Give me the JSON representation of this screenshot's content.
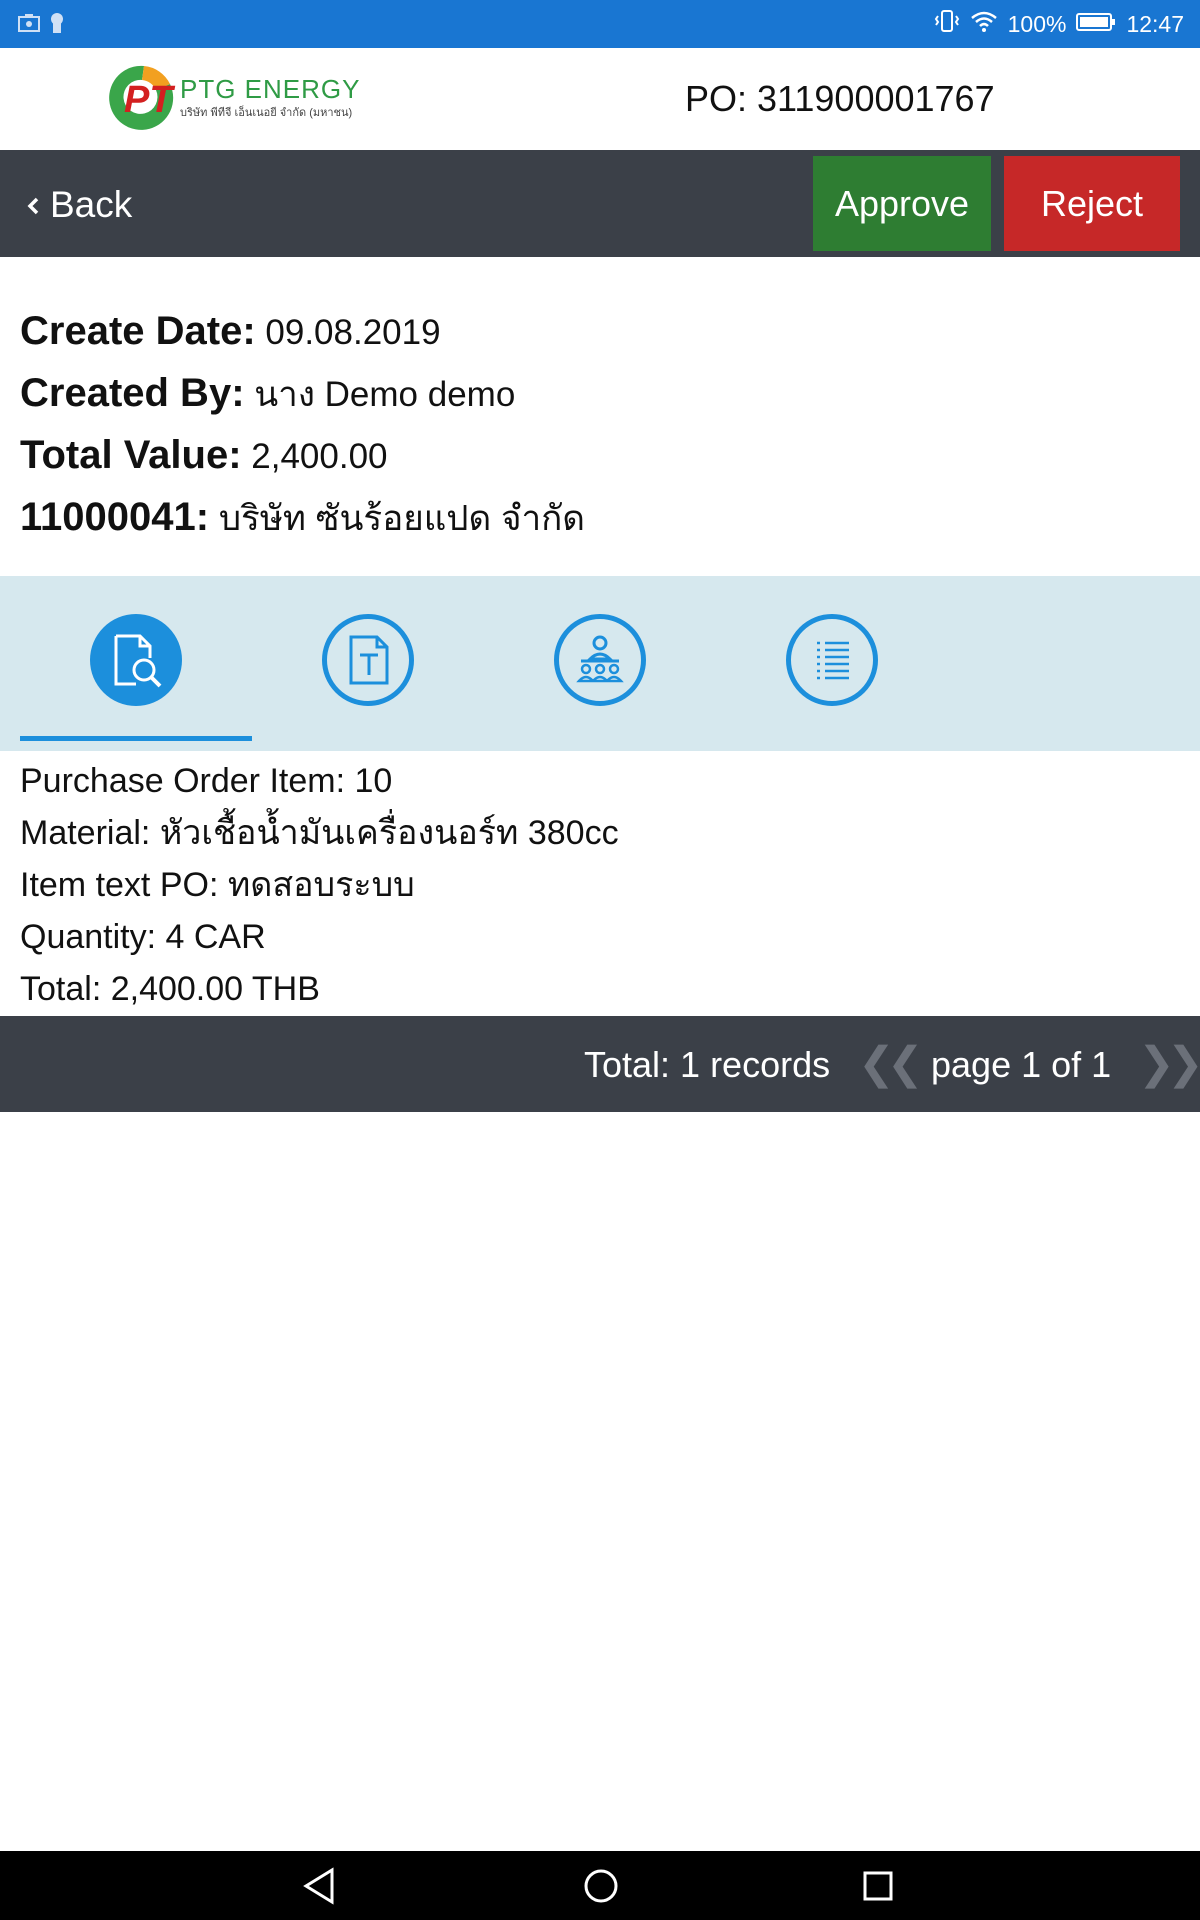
{
  "status_bar": {
    "battery": "100%",
    "time": "12:47"
  },
  "header": {
    "logo_text": "PTG ENERGY",
    "logo_subtext": "บริษัท พีทีจี เอ็นเนอยี จำกัด (มหาชน)",
    "po_title": "PO: 311900001767"
  },
  "toolbar": {
    "back_label": "Back",
    "approve_label": "Approve",
    "reject_label": "Reject"
  },
  "summary": {
    "create_date_label": "Create Date:",
    "create_date_value": "09.08.2019",
    "created_by_label": "Created By:",
    "created_by_value": "นาง Demo demo",
    "total_value_label": "Total Value:",
    "total_value_value": "2,400.00",
    "vendor_code_label": "11000041:",
    "vendor_name": "บริษัท ซันร้อยแปด จำกัด"
  },
  "tabs": [
    {
      "icon": "document-search-icon",
      "active": true
    },
    {
      "icon": "text-document-icon",
      "active": false
    },
    {
      "icon": "people-icon",
      "active": false
    },
    {
      "icon": "list-icon",
      "active": false
    }
  ],
  "item": {
    "po_item": "Purchase Order Item: 10",
    "material": "Material: หัวเชื้อน้ำมันเครื่องนอร์ท 380cc",
    "item_text": "Item text PO: ทดสอบระบบ",
    "quantity": "Quantity: 4  CAR",
    "total": "Total: 2,400.00  THB"
  },
  "pager": {
    "total_records": "Total: 1 records",
    "page_label": "page 1 of 1"
  },
  "colors": {
    "status_bar": "#1976d2",
    "toolbar": "#3b4048",
    "approve": "#2e7d32",
    "reject": "#c62828",
    "tab_accent": "#1c8fdc",
    "tab_bar_bg": "#d6e8ee"
  }
}
